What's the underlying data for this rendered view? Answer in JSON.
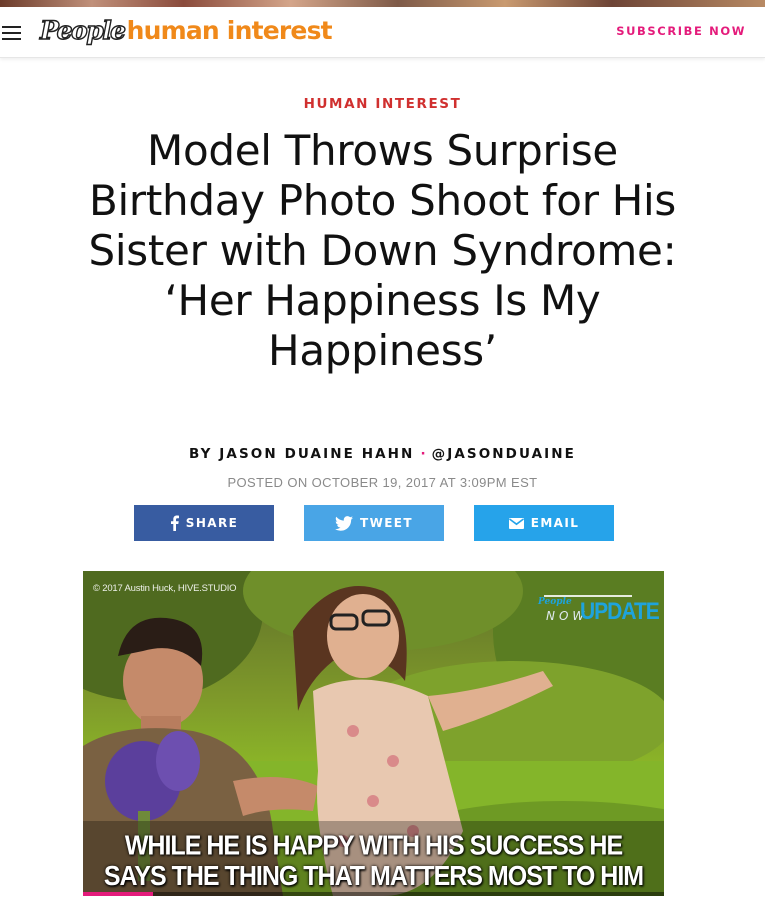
{
  "header": {
    "logo_brand": "People",
    "logo_section": "human interest",
    "subscribe_label": "SUBSCRIBE NOW"
  },
  "article": {
    "kicker": "HUMAN INTEREST",
    "headline": "Model Throws Surprise Birthday Photo Shoot for His Sister with Down Syndrome: ‘Her Happiness Is My Happiness’",
    "byline_prefix": "BY JASON DUAINE HAHN",
    "byline_separator": "·",
    "byline_handle": "@JASONDUAINE",
    "posted": "POSTED ON OCTOBER 19, 2017 AT 3:09PM EST"
  },
  "share": {
    "facebook_label": "SHARE",
    "twitter_label": "TWEET",
    "email_label": "EMAIL",
    "facebook_color": "#385ca1",
    "twitter_color": "#49a5e6",
    "email_color": "#26a3ea"
  },
  "video": {
    "credit": "© 2017 Austin Huck, HIVE.STUDIO",
    "badge_brand": "People",
    "badge_now": "NOW",
    "badge_update": "UPDATE",
    "caption_line1": "WHILE HE IS HAPPY WITH HIS SUCCESS HE",
    "caption_line2": "SAYS THE THING THAT MATTERS MOST TO HIM",
    "progress_fraction": 0.12
  },
  "colors": {
    "accent_pink": "#e41b7b",
    "kicker_red": "#d0302f",
    "logo_orange": "#f0891a"
  }
}
